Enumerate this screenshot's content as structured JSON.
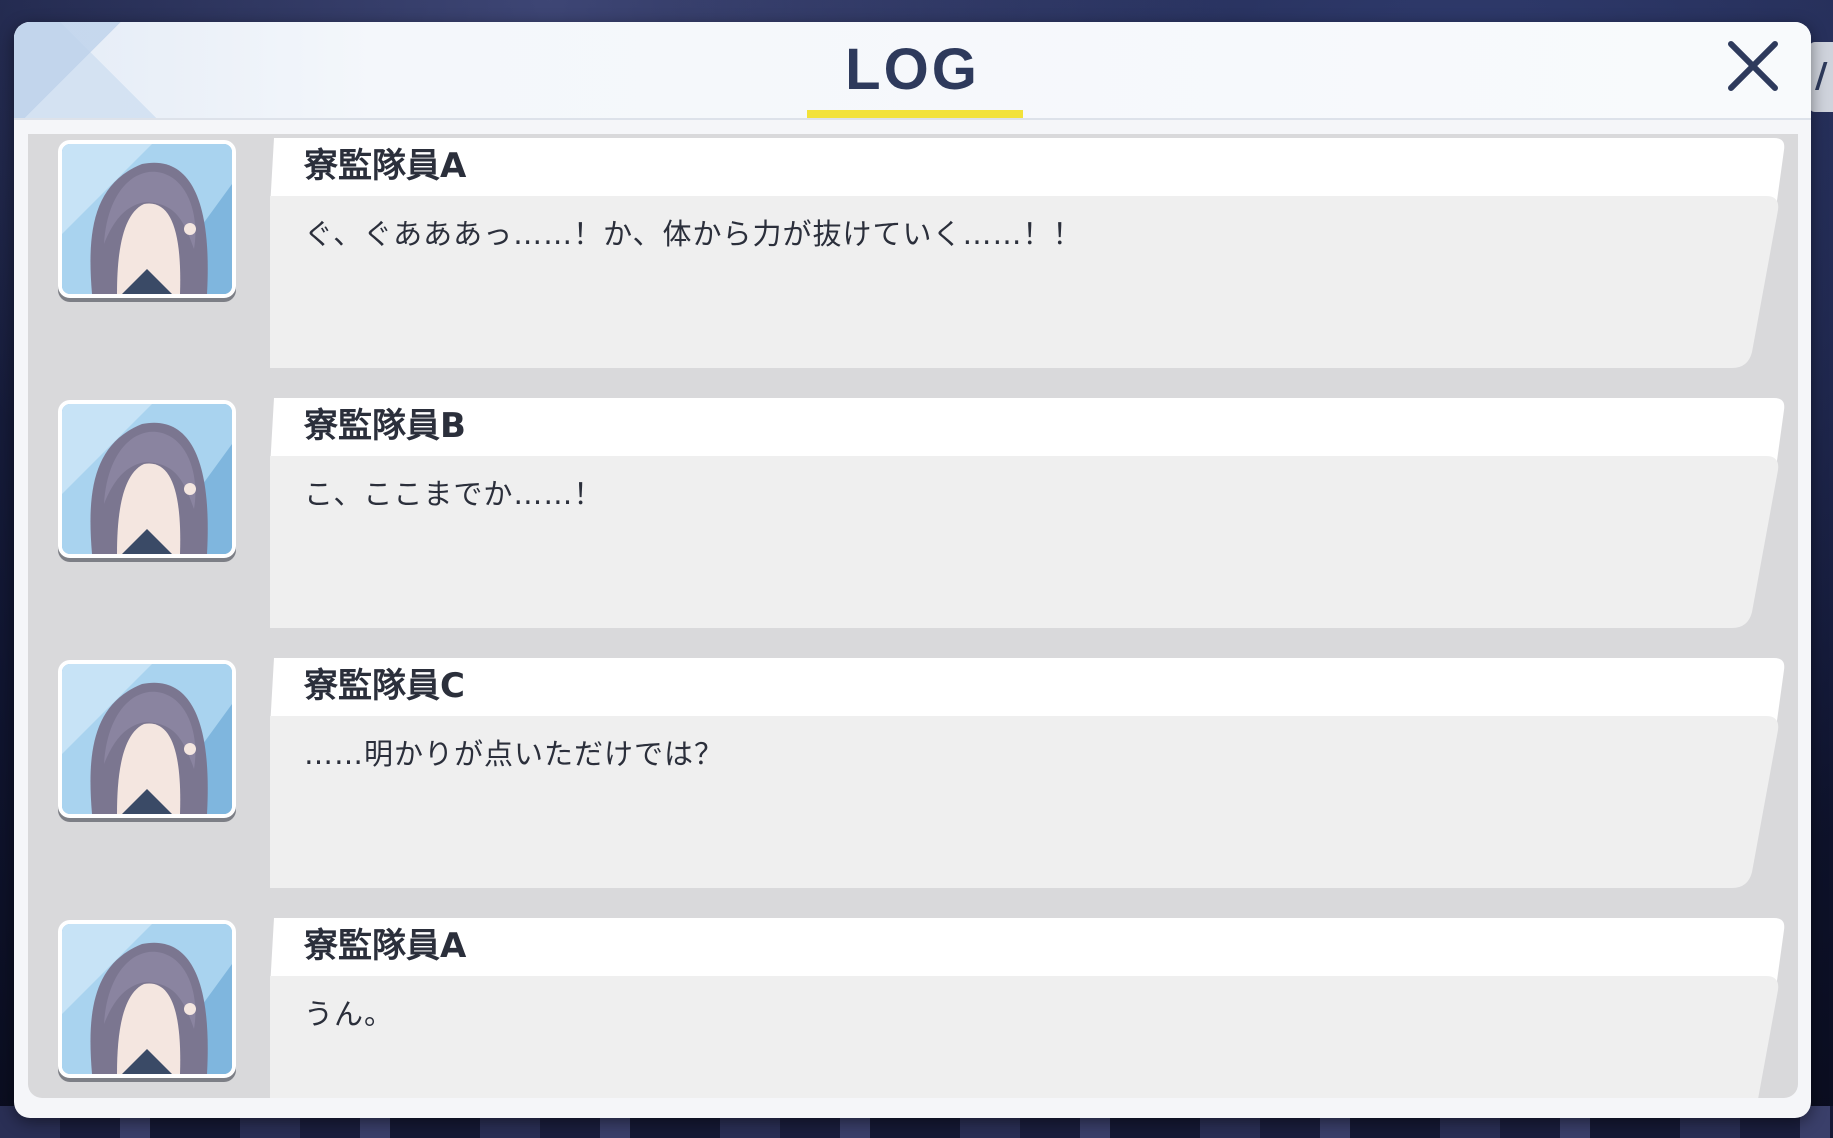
{
  "window": {
    "title": "LOG",
    "close_label": "✕",
    "right_peek_text": "/"
  },
  "log": {
    "entries": [
      {
        "speaker": "寮監隊員A",
        "message": "ぐ、ぐあああっ……！か、体から力が抜けていく……！！",
        "avatar_icon": "character-portrait"
      },
      {
        "speaker": "寮監隊員B",
        "message": "こ、ここまでか……！",
        "avatar_icon": "character-portrait"
      },
      {
        "speaker": "寮監隊員C",
        "message": "……明かりが点いただけでは？",
        "avatar_icon": "character-portrait"
      },
      {
        "speaker": "寮監隊員A",
        "message": "うん。",
        "avatar_icon": "character-portrait"
      }
    ]
  },
  "colors": {
    "title": "#2e3a5c",
    "underline": "#f2e23a",
    "panel": "#d9d9db",
    "bubble_body": "#efefef",
    "bubble_header": "#ffffff"
  }
}
